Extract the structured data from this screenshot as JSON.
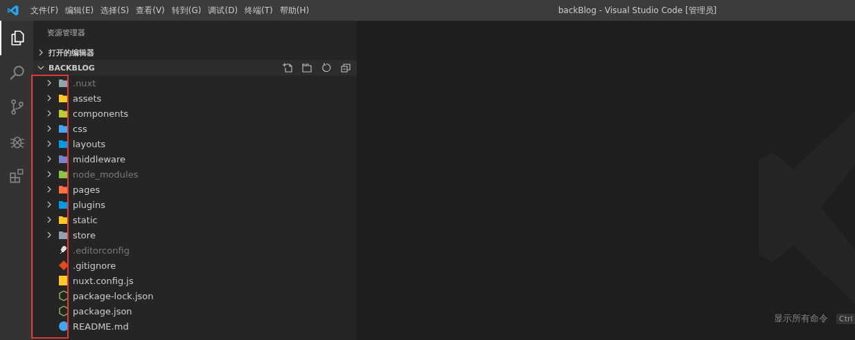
{
  "window": {
    "title": "backBlog - Visual Studio Code [管理员]"
  },
  "menu": [
    "文件(F)",
    "编辑(E)",
    "选择(S)",
    "查看(V)",
    "转到(G)",
    "调试(D)",
    "终端(T)",
    "帮助(H)"
  ],
  "activity_bar": [
    {
      "kind": "files",
      "selected": true
    },
    {
      "kind": "search",
      "selected": false
    },
    {
      "kind": "scm",
      "selected": false
    },
    {
      "kind": "debug",
      "selected": false
    },
    {
      "kind": "extensions",
      "selected": false
    }
  ],
  "sidebar": {
    "title": "资源管理器",
    "sections": [
      {
        "label": "打开的编辑器",
        "expanded": false
      },
      {
        "label": "BACKBLOG",
        "expanded": true
      }
    ],
    "tree": [
      {
        "name": ".nuxt",
        "kind": "folder",
        "color": "#90a4ae",
        "dimmed": true,
        "expanded": false
      },
      {
        "name": "assets",
        "kind": "folder",
        "color": "#ffca28",
        "dimmed": false,
        "expanded": false
      },
      {
        "name": "components",
        "kind": "folder",
        "color": "#c0ca33",
        "dimmed": false,
        "expanded": false
      },
      {
        "name": "css",
        "kind": "folder",
        "color": "#42a5f5",
        "dimmed": false,
        "expanded": false
      },
      {
        "name": "layouts",
        "kind": "folder",
        "color": "#039be5",
        "dimmed": false,
        "expanded": false
      },
      {
        "name": "middleware",
        "kind": "folder",
        "color": "#7986cb",
        "dimmed": false,
        "expanded": false
      },
      {
        "name": "node_modules",
        "kind": "folder",
        "color": "#8bc34a",
        "dimmed": true,
        "expanded": false
      },
      {
        "name": "pages",
        "kind": "folder",
        "color": "#ff7043",
        "dimmed": false,
        "expanded": false
      },
      {
        "name": "plugins",
        "kind": "folder",
        "color": "#039be5",
        "dimmed": false,
        "expanded": false
      },
      {
        "name": "static",
        "kind": "folder",
        "color": "#ffca28",
        "dimmed": false,
        "expanded": false
      },
      {
        "name": "store",
        "kind": "folder",
        "color": "#90a4ae",
        "dimmed": false,
        "expanded": false
      },
      {
        "name": ".editorconfig",
        "kind": "config",
        "color": "#e0e0e0",
        "dimmed": true
      },
      {
        "name": ".gitignore",
        "kind": "git",
        "color": "#e64a19",
        "dimmed": false
      },
      {
        "name": "nuxt.config.js",
        "kind": "js",
        "color": "#ffca28",
        "dimmed": false
      },
      {
        "name": "package-lock.json",
        "kind": "node",
        "color": "#8bc34a",
        "dimmed": false
      },
      {
        "name": "package.json",
        "kind": "node",
        "color": "#8bc34a",
        "dimmed": false
      },
      {
        "name": "README.md",
        "kind": "info",
        "color": "#42a5f5",
        "dimmed": false
      }
    ]
  },
  "editor": {
    "hint": "显示所有命令",
    "key": "Ctrl"
  }
}
